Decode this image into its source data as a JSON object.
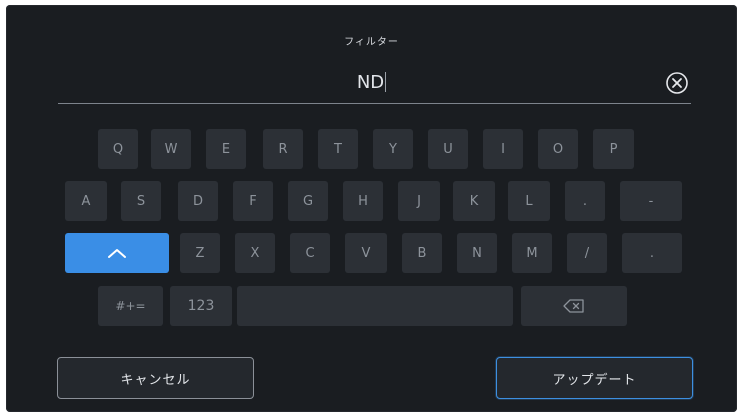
{
  "dialog": {
    "title": "フィルター",
    "input_value": "ND"
  },
  "keyboard": {
    "row1": [
      "Q",
      "W",
      "E",
      "R",
      "T",
      "Y",
      "U",
      "I",
      "O",
      "P"
    ],
    "row2": [
      "A",
      "S",
      "D",
      "F",
      "G",
      "H",
      "J",
      "K",
      "L",
      ".",
      "-"
    ],
    "row3": [
      "Z",
      "X",
      "C",
      "V",
      "B",
      "N",
      "M",
      "/",
      "."
    ],
    "symbols_label": "#+=",
    "numbers_label": "123",
    "shift_icon": "chevron-up-icon",
    "backspace_icon": "backspace-icon",
    "clear_icon": "clear-circle-x-icon"
  },
  "footer": {
    "cancel_label": "キャンセル",
    "update_label": "アップデート"
  },
  "colors": {
    "background": "#1a1d21",
    "key": "#2c3036",
    "accent": "#3a8ee6",
    "text": "#e2e5ea"
  }
}
